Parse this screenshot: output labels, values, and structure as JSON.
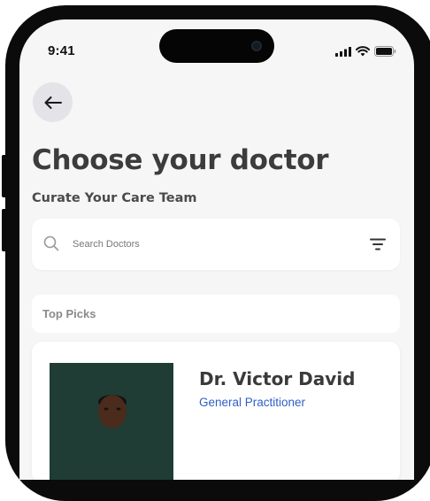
{
  "status_bar": {
    "time": "9:41"
  },
  "header": {
    "title": "Choose your doctor",
    "subtitle": "Curate Your Care Team"
  },
  "search": {
    "placeholder": "Search Doctors"
  },
  "section": {
    "top_picks_label": "Top Picks"
  },
  "doctors": [
    {
      "name": "Dr. Victor David",
      "specialty": "General Practitioner"
    }
  ],
  "colors": {
    "screen_bg": "#f6f6f6",
    "frame": "#0b0b0b",
    "title_text": "#3c3c3c",
    "specialty_link": "#2f5fc4",
    "back_button_bg": "#e3e3e8",
    "photo_bg": "#1f3d34"
  },
  "icons": [
    "back-arrow-icon",
    "search-icon",
    "filter-icon",
    "signal-icon",
    "wifi-icon",
    "battery-icon"
  ]
}
